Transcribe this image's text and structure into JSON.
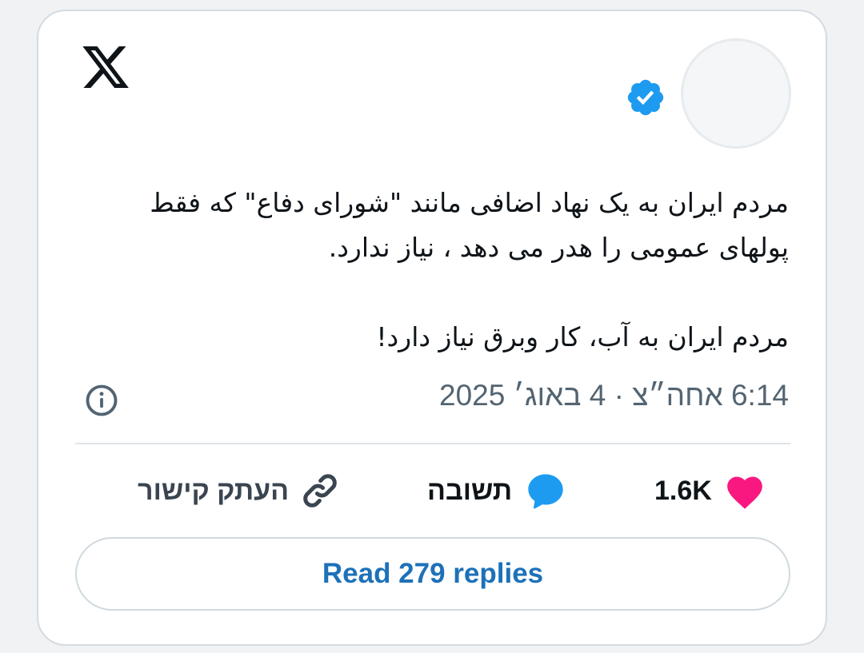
{
  "tweet": {
    "lines": [
      "مردم ایران به یک نهاد اضافی مانند \"شورای دفاع\" که فقط",
      "پولهای عمومی را هدر می دهد ، نیاز ندارد.",
      "مردم ایران به آب، کار وبرق نیاز دارد!"
    ],
    "timestamp": "6:14 אחה״צ · 4 באוג׳ 2025"
  },
  "icons": {
    "logo": "x-logo-icon",
    "verified": "verified-badge-icon",
    "info": "info-icon",
    "like": "heart-icon",
    "reply": "reply-bubble-icon",
    "copy": "link-icon"
  },
  "actions": {
    "like_count": "1.6K",
    "reply_label": "תשובה",
    "copy_label": "העתק קישור"
  },
  "read_replies_label": "Read 279 replies",
  "colors": {
    "verified": "#1d9bf0",
    "heart": "#f91880",
    "reply": "#1d9bf0",
    "button_text": "#1d71b8"
  }
}
